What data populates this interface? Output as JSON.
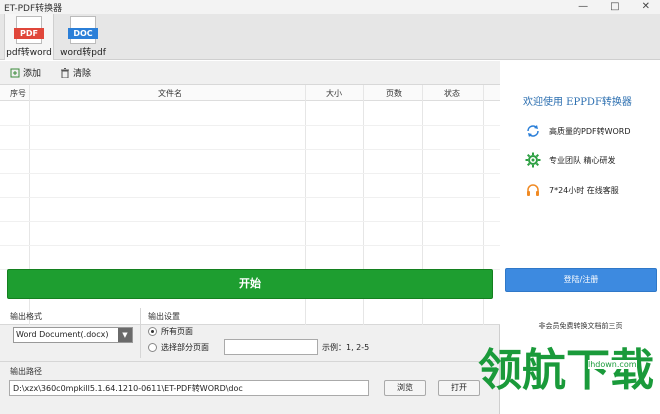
{
  "window": {
    "title": "ET-PDF转换器",
    "controls": [
      "—",
      "□",
      "✕"
    ]
  },
  "ribbon": {
    "tabs": [
      {
        "label": "pdf转word",
        "icon_text": "PDF",
        "icon": "pdf-file-icon",
        "color": "#e0463a",
        "active": true
      },
      {
        "label": "word转pdf",
        "icon_text": "DOC",
        "icon": "doc-file-icon",
        "color": "#2b7fd8",
        "active": false
      }
    ]
  },
  "toolbar": {
    "add_label": "添加",
    "clear_label": "清除"
  },
  "table": {
    "columns": [
      "序号",
      "文件名",
      "大小",
      "页数",
      "状态"
    ],
    "rows": []
  },
  "actions": {
    "start_label": "开始"
  },
  "output_format": {
    "label": "输出格式",
    "selected": "Word Document(.docx)"
  },
  "output_settings": {
    "label": "输出设置",
    "all_pages_label": "所有页面",
    "partial_pages_label": "选择部分页面",
    "range_value": "",
    "example": "示例：1, 2-5",
    "selected": "all_pages"
  },
  "output_path": {
    "label": "输出路径",
    "value": "D:\\xzx\\360c0mpkill5.1.64.1210-0611\\ET-PDF转WORD\\doc",
    "browse_label": "浏览",
    "open_label": "打开"
  },
  "sidebar": {
    "welcome": "欢迎使用 EPPDF转换器",
    "features": [
      {
        "icon": "refresh-icon",
        "text": "高质量的PDF转WORD"
      },
      {
        "icon": "gear-icon",
        "text": "专业团队 精心研发"
      },
      {
        "icon": "headset-icon",
        "text": "7*24小时 在线客服"
      }
    ],
    "login_label": "登陆/注册",
    "note": "非会员免费转换文档前三页"
  },
  "watermark": {
    "text": "领航下载",
    "url": "lhdown.com"
  },
  "colors": {
    "start_button": "#1e9e30",
    "login_button": "#3d8ae0",
    "welcome_text": "#2c6fb0"
  }
}
